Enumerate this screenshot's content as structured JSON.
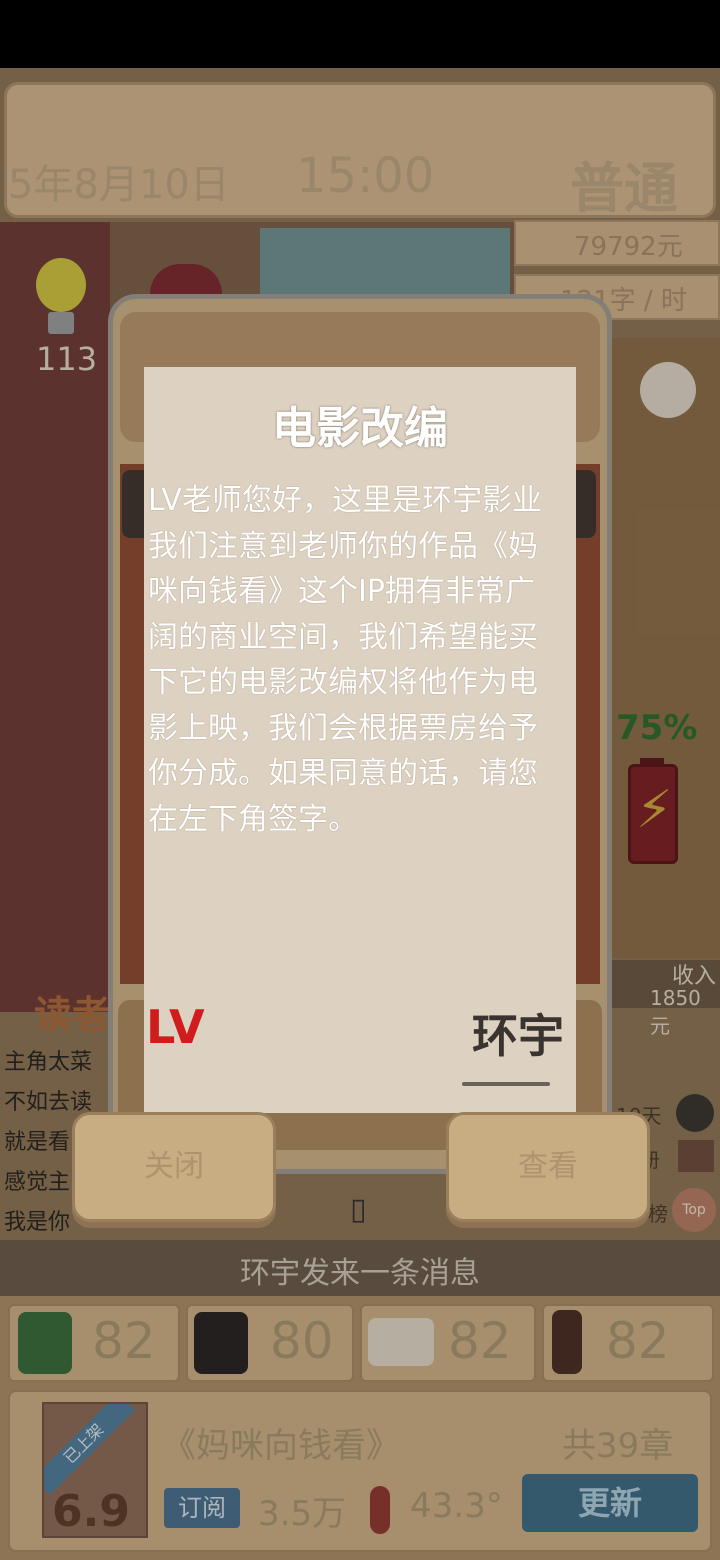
{
  "header": {
    "date": "5年8月10日",
    "time": "15:00",
    "mode": "普通",
    "money": "79792元",
    "speed": "121字 / 时"
  },
  "stats": {
    "inspiration": "113",
    "battery_percent": "75%",
    "income_label": "收入",
    "income_value": "1850元"
  },
  "readers": {
    "title": "读者",
    "comments": [
      "主角太菜",
      "不如去读",
      "就是看",
      "感觉主",
      "我是你"
    ]
  },
  "side": {
    "days": "10天",
    "register": "册",
    "rank": "榜",
    "top_badge": "Top"
  },
  "message_banner": "环宇发来一条消息",
  "attributes": [
    {
      "icon": "tree-icon",
      "value": "82"
    },
    {
      "icon": "character-icon",
      "value": "80"
    },
    {
      "icon": "book-icon",
      "value": "82"
    },
    {
      "icon": "pencil-icon",
      "value": "82"
    }
  ],
  "book": {
    "status": "已上架",
    "rating": "6.9",
    "title": "《妈咪向钱看》",
    "chapters": "共39章",
    "subscribe_label": "订阅",
    "subscribers": "3.5万",
    "temperature": "43.3°",
    "update_label": "更新"
  },
  "dialog": {
    "title": "电影改编",
    "body": "LV老师您好，这里是环宇影业我们注意到老师你的作品《妈咪向钱看》这个IP拥有非常广阔的商业空间，我们希望能买下它的电影改编权将他作为电影上映，我们会根据票房给予你分成。如果同意的话，请您在左下角签字。",
    "signature_left": "LV",
    "signature_right": "环宇",
    "close_label": "关闭",
    "view_label": "查看"
  },
  "colors": {
    "dialog_bg": "#ddd1c1",
    "signature_red": "#d01c1c",
    "update_button": "#3f6b82"
  }
}
